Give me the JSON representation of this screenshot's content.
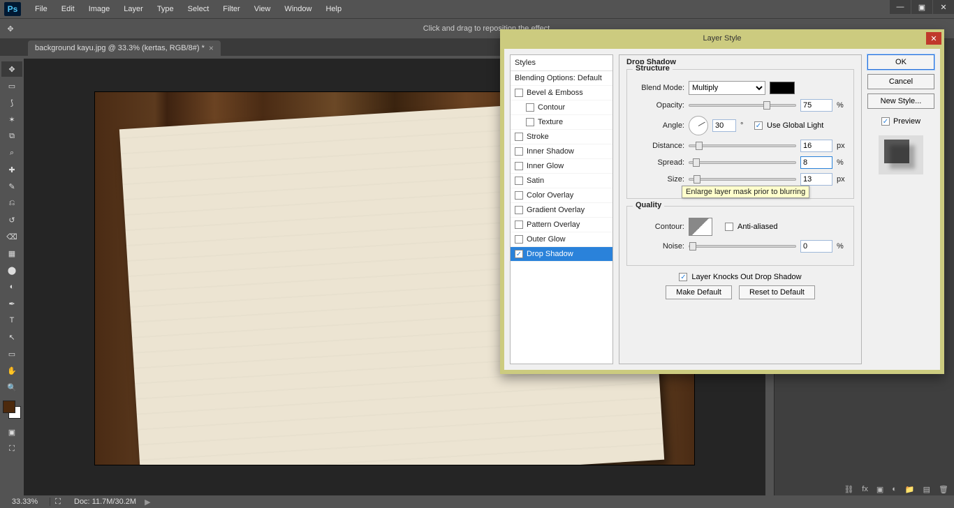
{
  "menubar": {
    "items": [
      "File",
      "Edit",
      "Image",
      "Layer",
      "Type",
      "Select",
      "Filter",
      "View",
      "Window",
      "Help"
    ]
  },
  "logo": "Ps",
  "optionbar": {
    "hint": "Click and drag to reposition the effect."
  },
  "tab": {
    "title": "background kayu.jpg @ 33.3% (kertas, RGB/8#) *"
  },
  "status": {
    "zoom": "33.33%",
    "doc": "Doc: 11.7M/30.2M"
  },
  "dialog": {
    "title": "Layer Style",
    "styles_header": "Styles",
    "blending": "Blending Options: Default",
    "items": [
      {
        "label": "Bevel & Emboss",
        "checked": false,
        "indent": false
      },
      {
        "label": "Contour",
        "checked": false,
        "indent": true
      },
      {
        "label": "Texture",
        "checked": false,
        "indent": true
      },
      {
        "label": "Stroke",
        "checked": false,
        "indent": false
      },
      {
        "label": "Inner Shadow",
        "checked": false,
        "indent": false
      },
      {
        "label": "Inner Glow",
        "checked": false,
        "indent": false
      },
      {
        "label": "Satin",
        "checked": false,
        "indent": false
      },
      {
        "label": "Color Overlay",
        "checked": false,
        "indent": false
      },
      {
        "label": "Gradient Overlay",
        "checked": false,
        "indent": false
      },
      {
        "label": "Pattern Overlay",
        "checked": false,
        "indent": false
      },
      {
        "label": "Outer Glow",
        "checked": false,
        "indent": false
      },
      {
        "label": "Drop Shadow",
        "checked": true,
        "indent": false,
        "selected": true
      }
    ],
    "section_title": "Drop Shadow",
    "structure": "Structure",
    "blend_mode_label": "Blend Mode:",
    "blend_mode_value": "Multiply",
    "opacity_label": "Opacity:",
    "opacity_value": "75",
    "opacity_unit": "%",
    "angle_label": "Angle:",
    "angle_value": "30",
    "angle_unit": "°",
    "global_light": "Use Global Light",
    "distance_label": "Distance:",
    "distance_value": "16",
    "distance_unit": "px",
    "spread_label": "Spread:",
    "spread_value": "8",
    "spread_unit": "%",
    "size_label": "Size:",
    "size_value": "13",
    "size_unit": "px",
    "tooltip": "Enlarge layer mask prior to blurring",
    "quality": "Quality",
    "contour_label": "Contour:",
    "anti_aliased": "Anti-aliased",
    "noise_label": "Noise:",
    "noise_value": "0",
    "noise_unit": "%",
    "knocks": "Layer Knocks Out Drop Shadow",
    "make_default": "Make Default",
    "reset_default": "Reset to Default",
    "ok": "OK",
    "cancel": "Cancel",
    "new_style": "New Style...",
    "preview": "Preview"
  }
}
